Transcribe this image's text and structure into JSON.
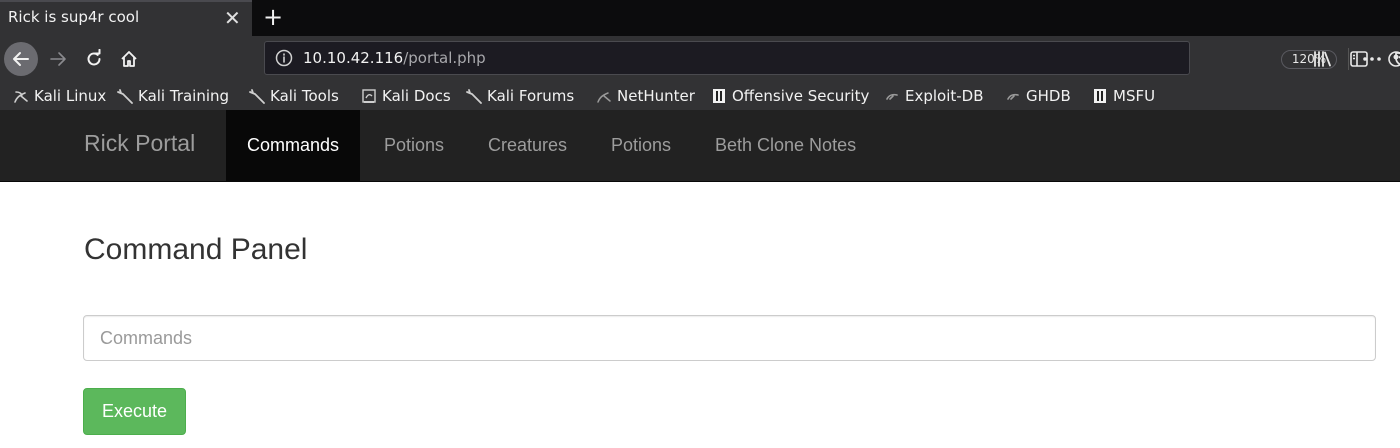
{
  "browser": {
    "tab": {
      "title": "Rick is sup4r cool",
      "close": "✕"
    },
    "new_tab": "+",
    "url": {
      "host": "10.10.42.116",
      "path": "/portal.php"
    },
    "zoom": "120%",
    "bookmarks": [
      {
        "label": "Kali Linux",
        "icon": "kali-dragon-icon"
      },
      {
        "label": "Kali Training",
        "icon": "kali-dragon-icon"
      },
      {
        "label": "Kali Tools",
        "icon": "kali-dragon-icon"
      },
      {
        "label": "Kali Docs",
        "icon": "kali-docs-icon"
      },
      {
        "label": "Kali Forums",
        "icon": "kali-dragon-icon"
      },
      {
        "label": "NetHunter",
        "icon": "nethunter-icon"
      },
      {
        "label": "Offensive Security",
        "icon": "offsec-icon"
      },
      {
        "label": "Exploit-DB",
        "icon": "exploitdb-icon"
      },
      {
        "label": "GHDB",
        "icon": "exploitdb-icon"
      },
      {
        "label": "MSFU",
        "icon": "offsec-icon"
      }
    ]
  },
  "site_nav": {
    "brand": "Rick Portal",
    "links": [
      "Commands",
      "Potions",
      "Creatures",
      "Potions",
      "Beth Clone Notes"
    ]
  },
  "panel": {
    "title": "Command Panel",
    "input_placeholder": "Commands",
    "execute_label": "Execute"
  },
  "colors": {
    "execute_green": "#5cb85c",
    "navbar_dark": "#222222"
  }
}
